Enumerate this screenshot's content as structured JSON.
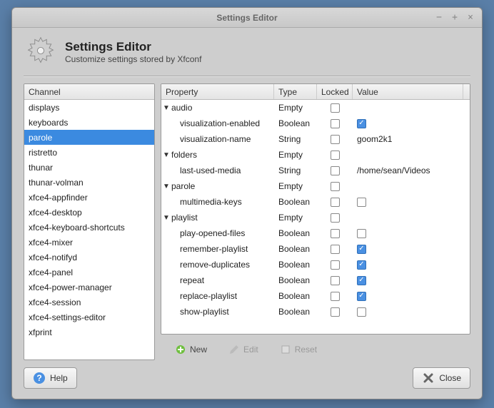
{
  "window": {
    "title": "Settings Editor"
  },
  "header": {
    "title": "Settings Editor",
    "subtitle": "Customize settings stored by Xfconf"
  },
  "channels": {
    "header": "Channel",
    "items": [
      "displays",
      "keyboards",
      "parole",
      "ristretto",
      "thunar",
      "thunar-volman",
      "xfce4-appfinder",
      "xfce4-desktop",
      "xfce4-keyboard-shortcuts",
      "xfce4-mixer",
      "xfce4-notifyd",
      "xfce4-panel",
      "xfce4-power-manager",
      "xfce4-session",
      "xfce4-settings-editor",
      "xfprint"
    ],
    "selected": "parole"
  },
  "properties": {
    "headers": {
      "property": "Property",
      "type": "Type",
      "locked": "Locked",
      "value": "Value"
    },
    "rows": [
      {
        "kind": "group",
        "name": "audio",
        "type": "Empty",
        "locked": false
      },
      {
        "kind": "leaf",
        "name": "visualization-enabled",
        "type": "Boolean",
        "locked": false,
        "value_bool": true
      },
      {
        "kind": "leaf",
        "name": "visualization-name",
        "type": "String",
        "locked": false,
        "value_text": "goom2k1"
      },
      {
        "kind": "group",
        "name": "folders",
        "type": "Empty",
        "locked": false
      },
      {
        "kind": "leaf",
        "name": "last-used-media",
        "type": "String",
        "locked": false,
        "value_text": "/home/sean/Videos"
      },
      {
        "kind": "group",
        "name": "parole",
        "type": "Empty",
        "locked": false
      },
      {
        "kind": "leaf",
        "name": "multimedia-keys",
        "type": "Boolean",
        "locked": false,
        "value_bool": false
      },
      {
        "kind": "group",
        "name": "playlist",
        "type": "Empty",
        "locked": false
      },
      {
        "kind": "leaf",
        "name": "play-opened-files",
        "type": "Boolean",
        "locked": false,
        "value_bool": false
      },
      {
        "kind": "leaf",
        "name": "remember-playlist",
        "type": "Boolean",
        "locked": false,
        "value_bool": true
      },
      {
        "kind": "leaf",
        "name": "remove-duplicates",
        "type": "Boolean",
        "locked": false,
        "value_bool": true
      },
      {
        "kind": "leaf",
        "name": "repeat",
        "type": "Boolean",
        "locked": false,
        "value_bool": true
      },
      {
        "kind": "leaf",
        "name": "replace-playlist",
        "type": "Boolean",
        "locked": false,
        "value_bool": true
      },
      {
        "kind": "leaf",
        "name": "show-playlist",
        "type": "Boolean",
        "locked": false,
        "value_bool": false
      }
    ]
  },
  "toolbar": {
    "new": "New",
    "edit": "Edit",
    "reset": "Reset"
  },
  "footer": {
    "help": "Help",
    "close": "Close"
  },
  "columns": {
    "property_w": 158,
    "type_w": 60,
    "locked_w": 50,
    "value_w": 155
  }
}
